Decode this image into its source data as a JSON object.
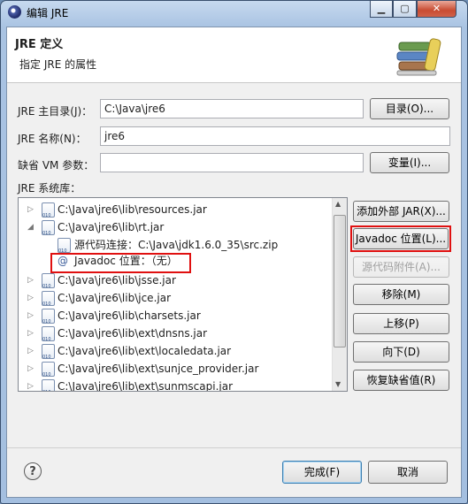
{
  "window": {
    "title": "编辑 JRE",
    "min": "▁",
    "max": "▢",
    "close": "✕"
  },
  "header": {
    "title": "JRE 定义",
    "subtitle": "指定 JRE 的属性"
  },
  "form": {
    "home_label": "JRE 主目录(J)：",
    "home_value": "C:\\Java\\jre6",
    "home_button": "目录(O)...",
    "name_label": "JRE 名称(N)：",
    "name_value": "jre6",
    "vm_label": "缺省 VM 参数：",
    "vm_value": "",
    "vm_button": "变量(I)...",
    "lib_label": "JRE 系统库："
  },
  "tree": {
    "rows": [
      {
        "text": "C:\\Java\\jre6\\lib\\resources.jar",
        "expander": "▷"
      },
      {
        "text": "C:\\Java\\jre6\\lib\\rt.jar",
        "expander": "◢"
      },
      {
        "text": "源代码连接：C:\\Java\\jdk1.6.0_35\\src.zip"
      },
      {
        "text": "Javadoc 位置：（无）",
        "icon": "@"
      },
      {
        "text": "C:\\Java\\jre6\\lib\\jsse.jar",
        "expander": "▷"
      },
      {
        "text": "C:\\Java\\jre6\\lib\\jce.jar",
        "expander": "▷"
      },
      {
        "text": "C:\\Java\\jre6\\lib\\charsets.jar",
        "expander": "▷"
      },
      {
        "text": "C:\\Java\\jre6\\lib\\ext\\dnsns.jar",
        "expander": "▷"
      },
      {
        "text": "C:\\Java\\jre6\\lib\\ext\\localedata.jar",
        "expander": "▷"
      },
      {
        "text": "C:\\Java\\jre6\\lib\\ext\\sunjce_provider.jar",
        "expander": "▷"
      },
      {
        "text": "C:\\Java\\jre6\\lib\\ext\\sunmscapi.jar",
        "expander": "▷"
      }
    ]
  },
  "side_buttons": {
    "add_jar": "添加外部 JAR(X)...",
    "javadoc": "Javadoc 位置(L)...",
    "source": "源代码附件(A)...",
    "remove": "移除(M)",
    "up": "上移(P)",
    "down": "向下(D)",
    "restore": "恢复缺省值(R)"
  },
  "footer": {
    "help": "?",
    "finish": "完成(F)",
    "cancel": "取消"
  },
  "colors": {
    "highlight": "#e01010",
    "accent": "#3c7fb1"
  }
}
